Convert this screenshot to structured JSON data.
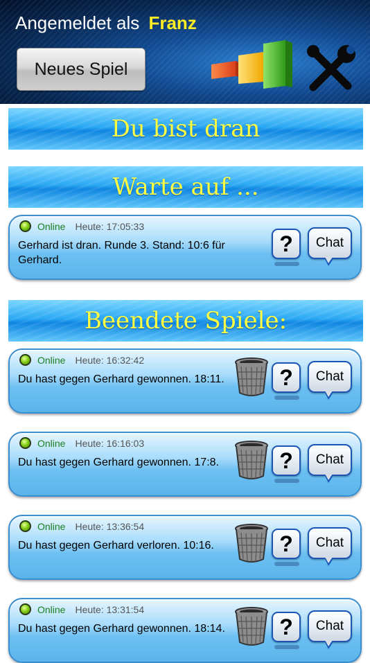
{
  "header": {
    "logged_in_prefix": "Angemeldet als",
    "username": "Franz",
    "new_game_label": "Neues Spiel",
    "stats_icon": "bar-chart-icon",
    "settings_icon": "tools-icon"
  },
  "sections": {
    "your_turn": "Du bist dran",
    "waiting": "Warte auf ...",
    "finished": "Beendete Spiele:"
  },
  "buttons": {
    "help_label": "?",
    "chat_label": "Chat"
  },
  "waiting_games": [
    {
      "status": "Online",
      "time": "Heute: 17:05:33",
      "message": "Gerhard ist dran. Runde 3. Stand: 10:6 für Gerhard."
    }
  ],
  "finished_games": [
    {
      "status": "Online",
      "time": "Heute: 16:32:42",
      "message": "Du hast gegen Gerhard gewonnen. 18:11."
    },
    {
      "status": "Online",
      "time": "Heute: 16:16:03",
      "message": "Du hast gegen Gerhard gewonnen. 17:8."
    },
    {
      "status": "Online",
      "time": "Heute: 13:36:54",
      "message": "Du hast gegen Gerhard verloren. 10:16."
    },
    {
      "status": "Online",
      "time": "Heute: 13:31:54",
      "message": "Du hast gegen Gerhard gewonnen. 18:14."
    }
  ],
  "colors": {
    "username": "#ffee22",
    "banner_text": "#ffff44",
    "online": "#1e7d1e",
    "button_border": "#1b56b5"
  }
}
